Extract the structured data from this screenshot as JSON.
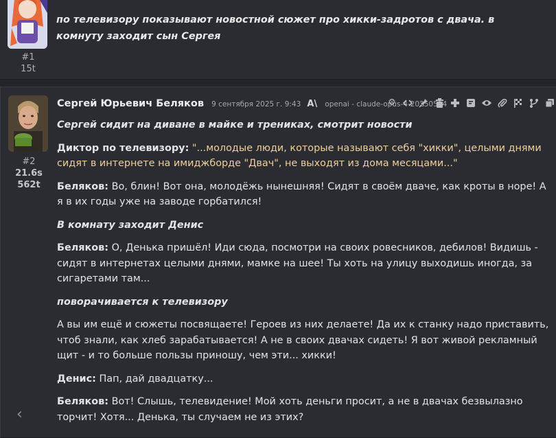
{
  "messages": [
    {
      "index": "#1",
      "tokens": "15t",
      "text": "по телевизору показывают новостной сюжет про хикки-задротов с двача. в комнуту заходит сын Сергея"
    },
    {
      "index": "#2",
      "time": "21.6s",
      "tokens": "562t",
      "author": "Сергей Юрьевич Беляков",
      "date": "9 сентября 2025 г. 9:43",
      "model": "openai - claude-opus-4-20250514",
      "paragraphs": {
        "p1": "Сергей сидит на диване в майке и трениках, смотрит новости",
        "p2_speaker": "Диктор по телевизору:",
        "p2_text": "\"...молодые люди, которые называют себя \"хикки\", целыми днями сидят в интернете на имиджборде \"Двач\", не выходят из дома месяцами...\"",
        "p3_speaker": "Беляков:",
        "p3_text": "Во, блин! Вот она, молодёжь нынешняя! Сидят в своём дваче, как кроты в норе! А я в их годы уже на заводе горбатился!",
        "p4": "В комнату заходит Денис",
        "p5_speaker": "Беляков:",
        "p5_text": "О, Денька пришёл! Иди сюда, посмотри на своих ровесников, дебилов! Видишь - сидят в интернетах целыми днями, мамке на шее! Ты хоть на улицу выходишь иногда, за сигаретами там...",
        "p6": "поворачивается к телевизору",
        "p7": "А вы им ещё и сюжеты посвящаете! Героев из них делаете! Да их к станку надо приставить, чтоб знали, как хлеб зарабатывается! А не в своих двачах сидеть! Я вот живой рекламный щит - и то больше пользы приношу, чем эти... хикки!",
        "p8_speaker": "Денис:",
        "p8_text": "Пап, дай двадцатку...",
        "p9_speaker": "Беляков:",
        "p9_text": "Вот! Слышь, телевидение! Мой хоть деньги просит, а не в двачах безвылазно торчит! Хотя... Денька, ты случаем не из этих?"
      }
    }
  ],
  "toolbar_icons": [
    "settings-icon",
    "code-icon",
    "pin-icon",
    "trash-icon",
    "add-icon",
    "note-icon",
    "eye-icon",
    "attachment-icon",
    "flag-icon",
    "branch-icon",
    "copy-icon"
  ],
  "nav": {
    "prev": "‹"
  },
  "colors": {
    "background": "#222429",
    "card": "#2b2c31",
    "quote": "#efcf9a"
  }
}
